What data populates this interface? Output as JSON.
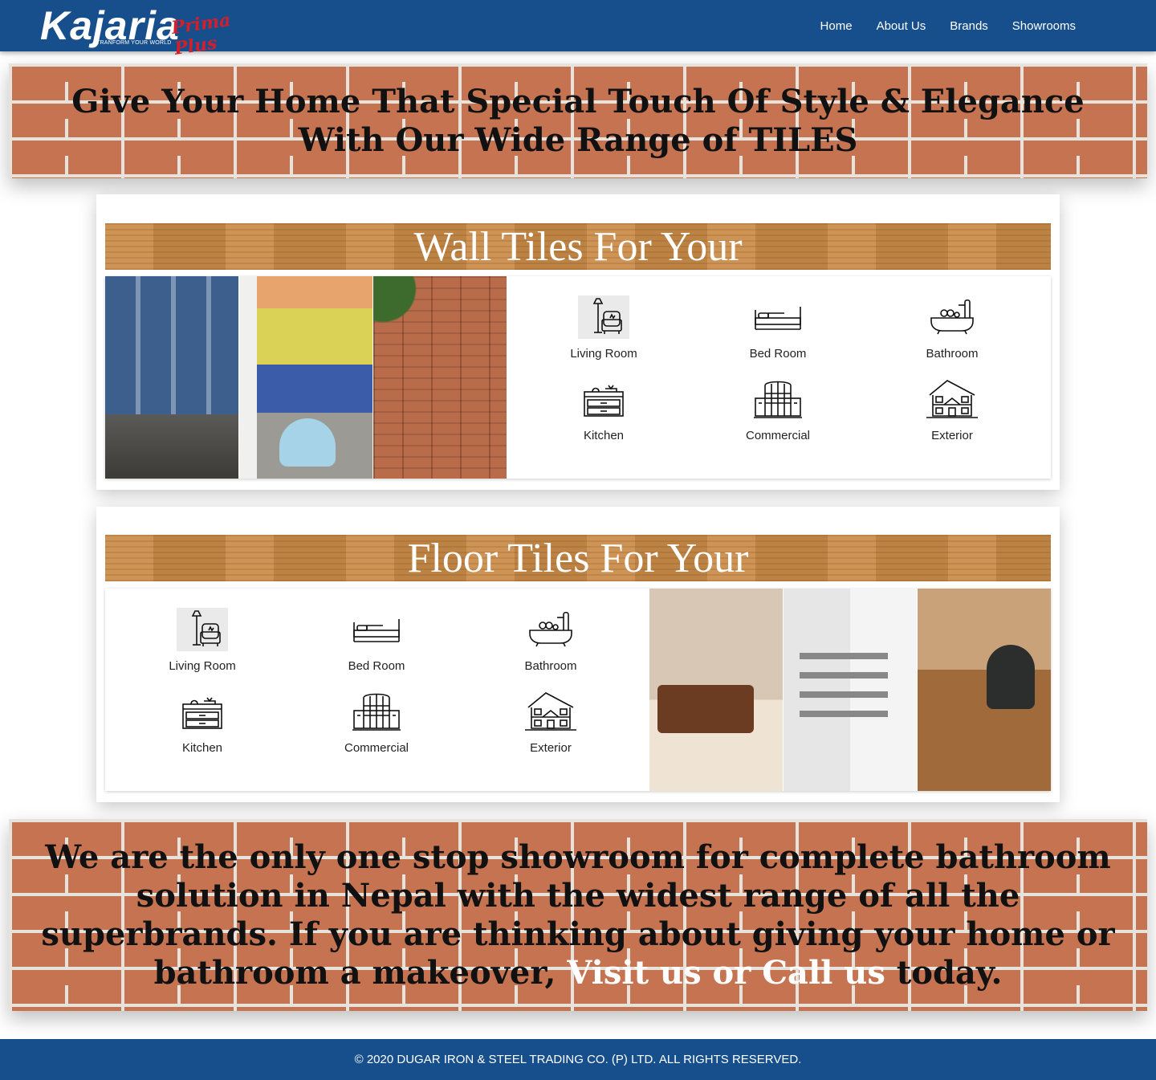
{
  "brand": {
    "name": "Kajaria",
    "tagline": "TRANFORM YOUR WORLD",
    "script": "Prima Plus"
  },
  "nav": {
    "items": [
      {
        "label": "Home"
      },
      {
        "label": "About Us"
      },
      {
        "label": "Brands"
      },
      {
        "label": "Showrooms"
      }
    ]
  },
  "hero": {
    "headline": "Give Your Home That Special Touch Of Style & Elegance With Our Wide Range of TILES"
  },
  "wall_section": {
    "title": "Wall Tiles For Your",
    "categories": [
      {
        "label": "Living Room",
        "icon": "armchair-lamp-icon"
      },
      {
        "label": "Bed Room",
        "icon": "bed-icon"
      },
      {
        "label": "Bathroom",
        "icon": "bathtub-icon"
      },
      {
        "label": "Kitchen",
        "icon": "kitchen-cabinet-icon"
      },
      {
        "label": "Commercial",
        "icon": "commercial-building-icon"
      },
      {
        "label": "Exterior",
        "icon": "house-icon"
      }
    ]
  },
  "floor_section": {
    "title": "Floor Tiles For Your",
    "categories": [
      {
        "label": "Living Room",
        "icon": "armchair-lamp-icon"
      },
      {
        "label": "Bed Room",
        "icon": "bed-icon"
      },
      {
        "label": "Bathroom",
        "icon": "bathtub-icon"
      },
      {
        "label": "Kitchen",
        "icon": "kitchen-cabinet-icon"
      },
      {
        "label": "Commercial",
        "icon": "commercial-building-icon"
      },
      {
        "label": "Exterior",
        "icon": "house-icon"
      }
    ]
  },
  "promo": {
    "text_before": "We are the only one stop showroom for complete bathroom solution in Nepal with the widest range of all the superbrands. If you are thinking about giving your home or bathroom a makeover, ",
    "highlight": "Visit us or Call us",
    "text_after": " today."
  },
  "footer": {
    "copyright": "© 2020 DUGAR IRON & STEEL TRADING CO. (P) LTD. ALL RIGHTS RESERVED."
  },
  "colors": {
    "navbar": "#174f8d",
    "brick": "#c57350",
    "wood": "#c98b48",
    "logo_script": "#d21f2b"
  }
}
